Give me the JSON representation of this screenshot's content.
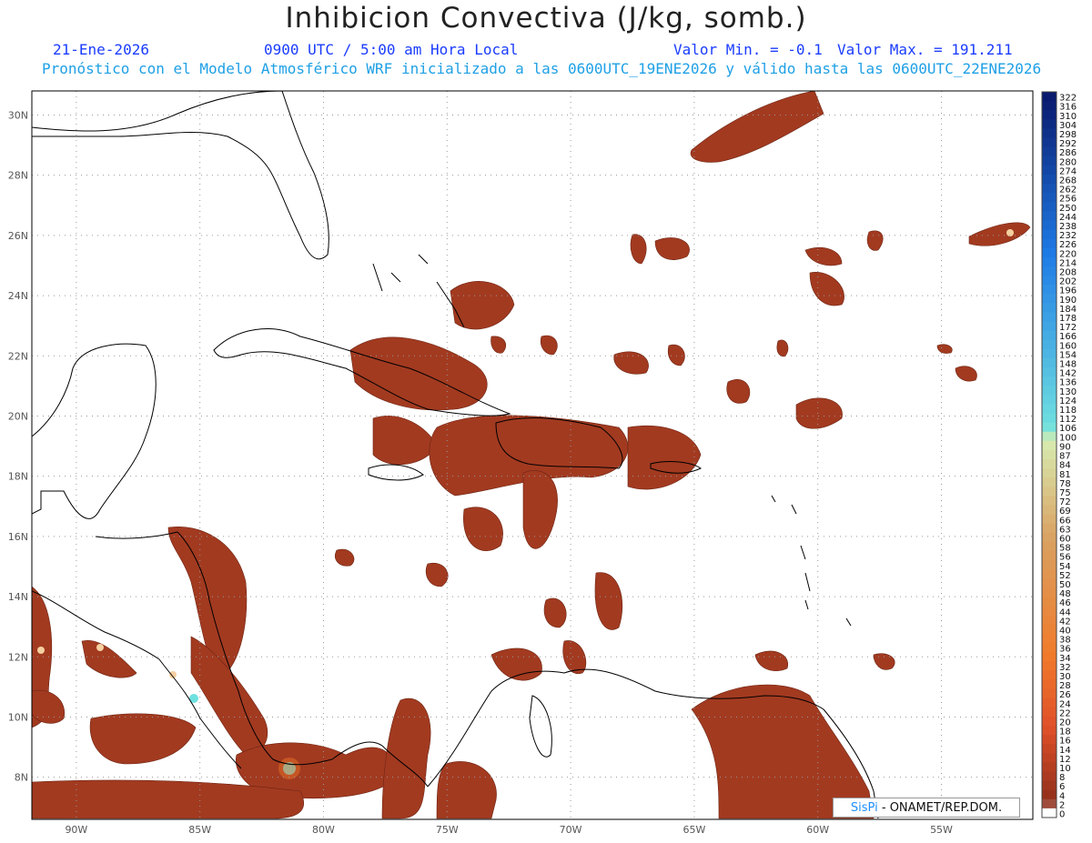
{
  "header": {
    "title": "Inhibicion Convectiva (J/kg, somb.)",
    "date": "21-Ene-2026",
    "time": "0900 UTC / 5:00 am Hora Local",
    "valmin": "Valor Min. = -0.1",
    "valmax": "Valor Max. = 191.211",
    "model_line": "Pronóstico con el Modelo Atmosférico WRF inicializado a las 0600UTC_19ENE2026 y válido hasta las  0600UTC_22ENE2026"
  },
  "axes": {
    "lon_labels": [
      "90W",
      "85W",
      "80W",
      "75W",
      "70W",
      "65W",
      "60W",
      "55W"
    ],
    "lon_values": [
      -90,
      -85,
      -80,
      -75,
      -70,
      -65,
      -60,
      -55
    ],
    "lat_labels": [
      "30N",
      "28N",
      "26N",
      "24N",
      "22N",
      "20N",
      "18N",
      "16N",
      "14N",
      "12N",
      "10N",
      "8N"
    ],
    "lat_values": [
      30,
      28,
      26,
      24,
      22,
      20,
      18,
      16,
      14,
      12,
      10,
      8
    ],
    "lon_range": [
      -91.8,
      -51.3
    ],
    "lat_range": [
      6.6,
      30.8
    ]
  },
  "colorbar": {
    "labels": [
      "322",
      "316",
      "310",
      "304",
      "298",
      "292",
      "286",
      "280",
      "274",
      "268",
      "262",
      "256",
      "250",
      "244",
      "238",
      "232",
      "226",
      "220",
      "214",
      "208",
      "202",
      "196",
      "190",
      "184",
      "178",
      "172",
      "166",
      "160",
      "154",
      "148",
      "142",
      "136",
      "130",
      "124",
      "118",
      "112",
      "106",
      "100",
      "90",
      "87",
      "84",
      "81",
      "78",
      "75",
      "72",
      "69",
      "66",
      "63",
      "60",
      "58",
      "56",
      "54",
      "52",
      "50",
      "48",
      "46",
      "44",
      "42",
      "40",
      "38",
      "36",
      "34",
      "32",
      "30",
      "28",
      "26",
      "24",
      "22",
      "20",
      "18",
      "16",
      "14",
      "12",
      "10",
      "8",
      "6",
      "4",
      "2",
      "0"
    ],
    "dark_blue": "#0a1a6e",
    "mid_blue": "#1e7be6",
    "cyan": "#6fe0e0",
    "light_green": "#d8ecb0",
    "tan": "#d9a060",
    "orange": "#f07a2a",
    "red_orange": "#e0502a",
    "dark_red": "#8f2e1a"
  },
  "field_color": "#a23a20",
  "credit": {
    "brand": "SisPi",
    "text": " - ONAMET/REP.DOM."
  }
}
